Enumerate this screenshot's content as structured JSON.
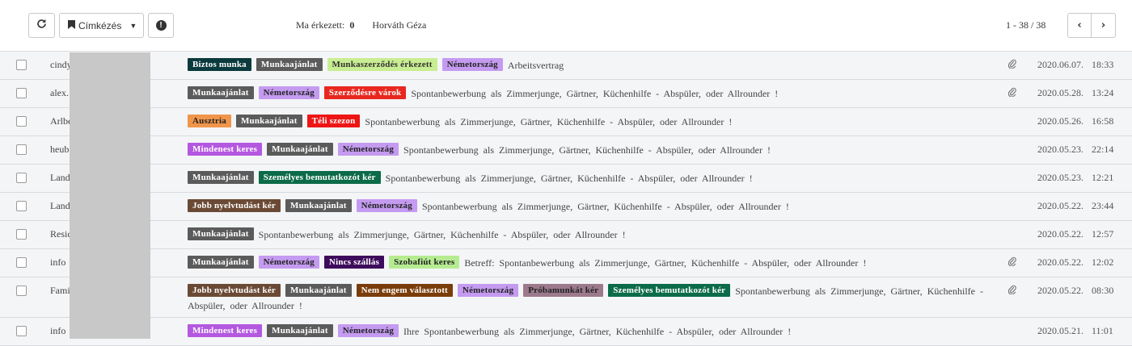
{
  "toolbar": {
    "refresh_icon": "refresh-icon",
    "label_button": "Címkézés",
    "bookmark_icon": "bookmark-icon",
    "caret_icon": "caret-down-icon",
    "info_icon": "info-icon",
    "info_glyph": "!",
    "today_label": "Ma érkezett:",
    "today_count": "0",
    "user_name": "Horváth Géza",
    "pager": "1 - 38 / 38"
  },
  "colors": {
    "Biztos munka": {
      "bg": "#0a3a3d",
      "fg": "#ffffff"
    },
    "Munkaajánlat": {
      "bg": "#5b5b5b",
      "fg": "#ffffff"
    },
    "Munkaszerződés érkezett": {
      "bg": "#c9ed92",
      "fg": "#333333"
    },
    "Németország": {
      "bg": "#c49bf0",
      "fg": "#222222"
    },
    "Szerződésre várok": {
      "bg": "#e8281f",
      "fg": "#ffffff"
    },
    "Ausztria": {
      "bg": "#f0954a",
      "fg": "#222222"
    },
    "Téli szezon": {
      "bg": "#ee1515",
      "fg": "#ffffff"
    },
    "Mindenest keres": {
      "bg": "#b458e0",
      "fg": "#ffffff"
    },
    "Személyes bemutatkozót kér": {
      "bg": "#0c6b48",
      "fg": "#ffffff"
    },
    "Jobb nyelvtudást kér": {
      "bg": "#6b4a35",
      "fg": "#ffffff"
    },
    "Nincs szállás": {
      "bg": "#3e0c5c",
      "fg": "#ffffff"
    },
    "Szobafiút keres": {
      "bg": "#b6ec91",
      "fg": "#222222"
    },
    "Nem engem választott": {
      "bg": "#7a3d0a",
      "fg": "#ffffff"
    },
    "Próbamunkát kér": {
      "bg": "#9c7a8c",
      "fg": "#222222"
    }
  },
  "rows": [
    {
      "sender": "cindy",
      "tags": [
        "Biztos munka",
        "Munkaajánlat",
        "Munkaszerződés érkezett",
        "Németország"
      ],
      "subject": "Arbeitsvertrag",
      "attachment": true,
      "date": "2020.06.07.",
      "time": "18:33"
    },
    {
      "sender": "alex.",
      "tags": [
        "Munkaajánlat",
        "Németország",
        "Szerződésre várok"
      ],
      "subject": "Spontanbewerbung als Zimmerjunge, Gärtner, Küchenhilfe - Abspüler, oder Allrounder !",
      "attachment": true,
      "date": "2020.05.28.",
      "time": "13:24"
    },
    {
      "sender": "Arlbe",
      "tags": [
        "Ausztria",
        "Munkaajánlat",
        "Téli szezon"
      ],
      "subject": "Spontanbewerbung als Zimmerjunge, Gärtner, Küchenhilfe - Abspüler, oder Allrounder !",
      "attachment": false,
      "date": "2020.05.26.",
      "time": "16:58"
    },
    {
      "sender": "heub",
      "tags": [
        "Mindenest keres",
        "Munkaajánlat",
        "Németország"
      ],
      "subject": "Spontanbewerbung als Zimmerjunge, Gärtner, Küchenhilfe - Abspüler, oder Allrounder !",
      "attachment": false,
      "date": "2020.05.23.",
      "time": "22:14"
    },
    {
      "sender": "Land",
      "tags": [
        "Munkaajánlat",
        "Személyes bemutatkozót kér"
      ],
      "subject": "Spontanbewerbung als Zimmerjunge, Gärtner, Küchenhilfe - Abspüler, oder Allrounder !",
      "attachment": false,
      "date": "2020.05.23.",
      "time": "12:21"
    },
    {
      "sender": "Land",
      "tags": [
        "Jobb nyelvtudást kér",
        "Munkaajánlat",
        "Németország"
      ],
      "subject": "Spontanbewerbung als Zimmerjunge, Gärtner, Küchenhilfe - Abspüler, oder Allrounder !",
      "attachment": false,
      "date": "2020.05.22.",
      "time": "23:44"
    },
    {
      "sender": "Resic",
      "tags": [
        "Munkaajánlat"
      ],
      "subject": "Spontanbewerbung als Zimmerjunge, Gärtner, Küchenhilfe - Abspüler, oder Allrounder !",
      "attachment": false,
      "date": "2020.05.22.",
      "time": "12:57"
    },
    {
      "sender": "info",
      "tags": [
        "Munkaajánlat",
        "Németország",
        "Nincs szállás",
        "Szobafiút keres"
      ],
      "subject": "Betreff: Spontanbewerbung als Zimmerjunge, Gärtner, Küchenhilfe - Abspüler, oder Allrounder !",
      "attachment": true,
      "date": "2020.05.22.",
      "time": "12:02"
    },
    {
      "sender": "Fami",
      "tags": [
        "Jobb nyelvtudást kér",
        "Munkaajánlat",
        "Nem engem választott",
        "Németország",
        "Próbamunkát kér",
        "Személyes bemutatkozót kér"
      ],
      "subject": "Spontanbewerbung als Zimmerjunge, Gärtner, Küchenhilfe - Abspüler, oder Allrounder !",
      "attachment": true,
      "date": "2020.05.22.",
      "time": "08:30",
      "tall": true
    },
    {
      "sender": "info",
      "tags": [
        "Mindenest keres",
        "Munkaajánlat",
        "Németország"
      ],
      "subject": "Ihre Spontanbewerbung als Zimmerjunge, Gärtner, Küchenhilfe - Abspüler, oder Allrounder !",
      "attachment": false,
      "date": "2020.05.21.",
      "time": "11:01"
    }
  ]
}
